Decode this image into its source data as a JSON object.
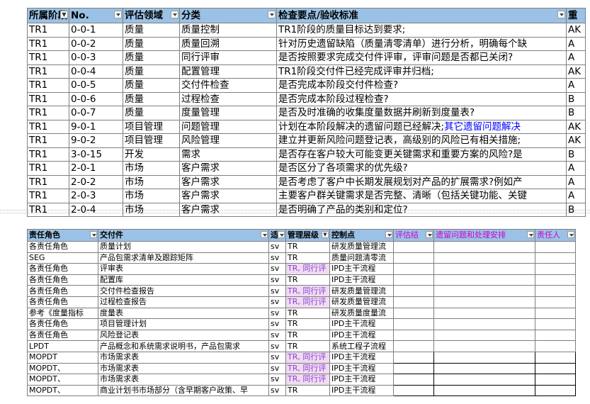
{
  "table1": {
    "headers": [
      "所属阶段",
      "No.",
      "评估领域",
      "分类",
      "检查要点/验收标准",
      "重"
    ],
    "rows": [
      [
        "TR1",
        "0-0-1",
        "质量",
        "质量控制",
        "TR1阶段的质量目标达到要求;",
        "",
        "AK"
      ],
      [
        "TR1",
        "0-0-2",
        "质量",
        "质量回溯",
        "针对历史遗留缺陷（质量清零清单）进行分析，明确每个缺",
        "",
        "A"
      ],
      [
        "TR1",
        "0-0-3",
        "质量",
        "同行评审",
        "是否按照要求完成交付件评审，评审问题是否都已关闭?",
        "",
        "A"
      ],
      [
        "TR1",
        "0-0-4",
        "质量",
        "配置管理",
        "TR1阶段交付件已经完成评审并归档;",
        "",
        "AK"
      ],
      [
        "TR1",
        "0-0-5",
        "质量",
        "交付件检查",
        "是否完成本阶段交付件检查?",
        "",
        "A"
      ],
      [
        "TR1",
        "0-0-6",
        "质量",
        "过程检查",
        "是否完成本阶段过程检查?",
        "",
        "B"
      ],
      [
        "TR1",
        "0-0-7",
        "质量",
        "度量管理",
        "是否及时准确的收集度量数据并刷新到度量表?",
        "",
        "B"
      ],
      [
        "TR1",
        "9-0-1",
        "项目管理",
        "问题管理",
        "计划在本阶段解决的遗留问题已经解决;",
        "其它遗留问题解决",
        "AK"
      ],
      [
        "TR1",
        "9-0-2",
        "项目管理",
        "风险管理",
        "建立并更新风险问题登记表，高级别的风险已有相关措施;",
        "",
        "AK"
      ],
      [
        "TR1",
        "3-0-15",
        "开发",
        "需求",
        "是否存在客户较大可能变更关键需求和重要方案的风险?是",
        "",
        "B"
      ],
      [
        "TR1",
        "2-0-1",
        "市场",
        "客户需求",
        "是否区分了各项需求的优先级?",
        "",
        "A"
      ],
      [
        "TR1",
        "2-0-2",
        "市场",
        "客户需求",
        "是否考虑了客户中长期发展规划对产品的扩展需求?例如产",
        "",
        "A"
      ],
      [
        "TR1",
        "2-0-3",
        "市场",
        "客户需求",
        "主要客户群关键需求是否完整、清晰（包括关键功能、关键",
        "",
        "A"
      ],
      [
        "TR1",
        "2-0-4",
        "市场",
        "客户需求",
        "是否明确了产品的类别和定位?",
        "",
        "B"
      ]
    ]
  },
  "table2": {
    "headers": [
      "责任角色",
      "交付件",
      "适",
      "管理层级",
      "控制点",
      "评估结",
      "遗留问题和处理安排",
      "责任人"
    ],
    "rows": [
      [
        "各责任角色",
        "质量计划",
        "sv",
        "TR",
        "研发质量管理流"
      ],
      [
        "SEG",
        "产品包需求清单及跟踪矩阵",
        "sv",
        "TR",
        "质量问题清零流"
      ],
      [
        "各责任角色",
        "评审表",
        "sv",
        "TR, 同行评",
        "IPD主干流程"
      ],
      [
        "各责任角色",
        "配置库",
        "sv",
        "TR",
        "IPD主干流程"
      ],
      [
        "各责任角色",
        "交付件检查报告",
        "sv",
        "TR, 同行评",
        "研发质量管理流"
      ],
      [
        "各责任角色",
        "过程检查报告",
        "sv",
        "TR, 同行评",
        "研发质量管理流"
      ],
      [
        "参考《度量指标",
        "度量表",
        "sv",
        "TR",
        "研发质量度量流"
      ],
      [
        "各责任角色",
        "项目管理计划",
        "sv",
        "TR",
        "IPD主干流程"
      ],
      [
        "各责任角色",
        "风险登记表",
        "sv",
        "TR",
        "IPD主干流程"
      ],
      [
        "LPDT",
        "产品概念和系统需求说明书，产品包需求",
        "sv",
        "TR",
        "系统工程子流程"
      ],
      [
        "MOPDT",
        "市场需求表",
        "sv",
        "TR, 同行评",
        "IPD主干流程"
      ],
      [
        "MOPDT、",
        "市场需求表",
        "sv",
        "TR, 同行评",
        "IPD主干流程"
      ],
      [
        "MOPDT、",
        "市场需求表",
        "sv",
        "TR, 同行评",
        "IPD主干流程"
      ],
      [
        "MOPDT、",
        "商业计划书市场部分（含早期客户政策、早",
        "sv",
        "TR",
        "IPD主干流程"
      ]
    ]
  }
}
